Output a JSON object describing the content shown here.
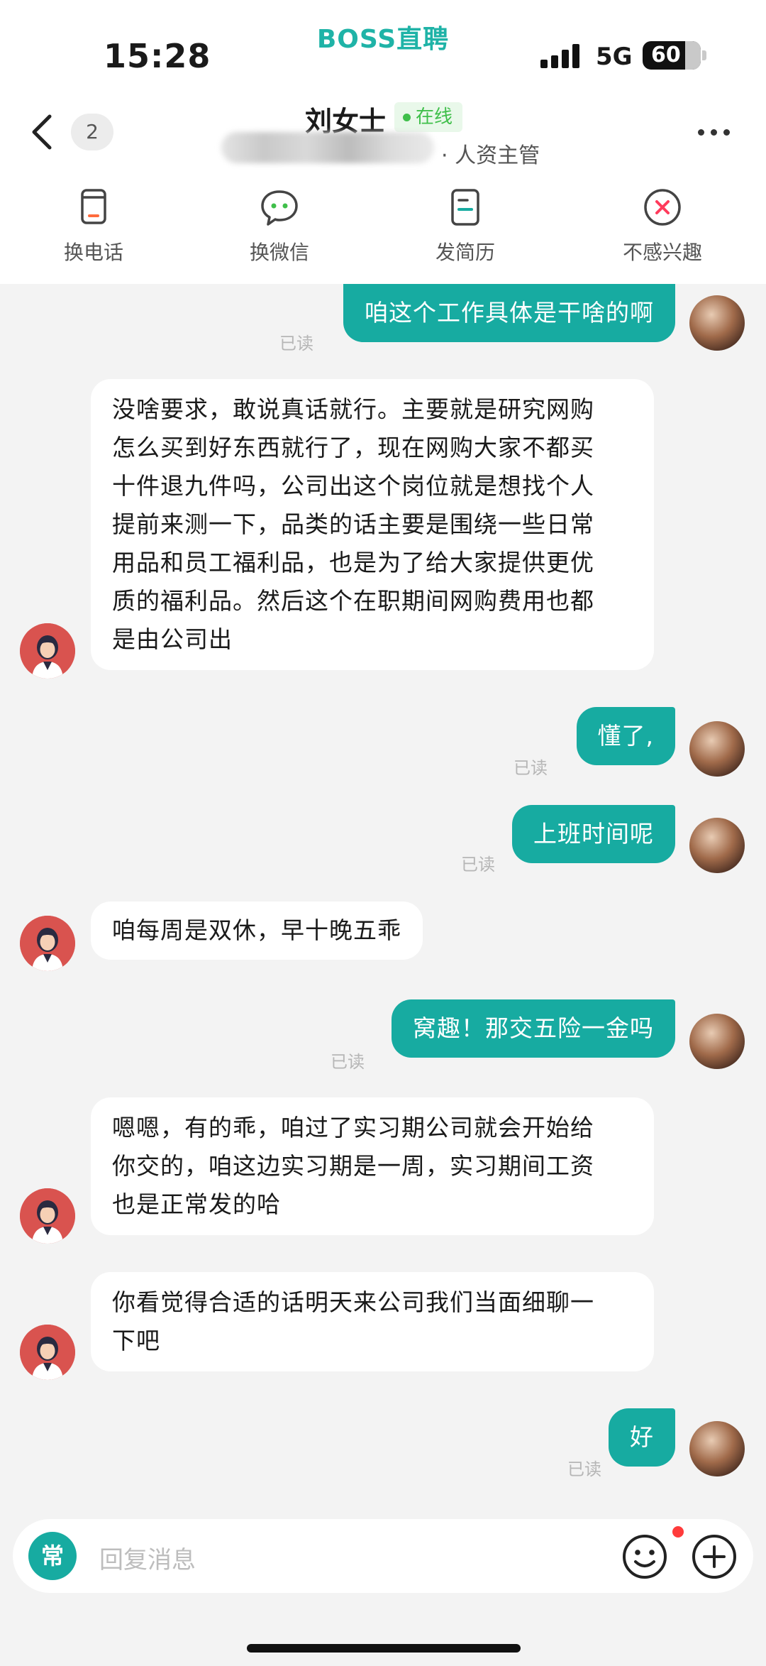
{
  "status_bar": {
    "time": "15:28",
    "network": "5G",
    "battery": "60"
  },
  "brand": "BOSS直聘",
  "header": {
    "unread_count": "2",
    "contact_name": "刘女士",
    "online_status": "在线",
    "role": "· 人资主管"
  },
  "actions": [
    {
      "label": "换电话",
      "icon": "phone-icon"
    },
    {
      "label": "换微信",
      "icon": "wechat-icon"
    },
    {
      "label": "发简历",
      "icon": "resume-icon"
    },
    {
      "label": "不感兴趣",
      "icon": "not-interested-icon"
    }
  ],
  "messages": [
    {
      "from": "me",
      "text": "咱这个工作具体是干啥的啊",
      "read": "已读"
    },
    {
      "from": "hr",
      "lines": [
        "没啥要求，敢说真话就行。主要就是研究网购",
        "怎么买到好东西就行了，现在网购大家不都买",
        "十件退九件吗，公司出这个岗位就是想找个人",
        "提前来测一下，品类的话主要是围绕一些日常",
        "用品和员工福利品，也是为了给大家提供更优",
        "质的福利品。然后这个在职期间网购费用也都",
        "是由公司出"
      ]
    },
    {
      "from": "me",
      "text": "懂了,",
      "read": "已读"
    },
    {
      "from": "me",
      "text": "上班时间呢",
      "read": "已读"
    },
    {
      "from": "hr",
      "lines": [
        "咱每周是双休，早十晚五乖"
      ]
    },
    {
      "from": "me",
      "text": "窝趣！那交五险一金吗",
      "read": "已读"
    },
    {
      "from": "hr",
      "lines": [
        "嗯嗯，有的乖，咱过了实习期公司就会开始给",
        "你交的，咱这边实习期是一周，实习期间工资",
        "也是正常发的哈"
      ]
    },
    {
      "from": "hr",
      "lines": [
        "你看觉得合适的话明天来公司我们当面细聊一",
        "下吧"
      ]
    },
    {
      "from": "me",
      "text": "好",
      "read": "已读"
    }
  ],
  "input": {
    "quick_reply": "常",
    "placeholder": "回复消息"
  },
  "colors": {
    "accent": "#17aba1",
    "brand": "#1fb3a7",
    "online": "#3fbf4a",
    "hr_avatar": "#d9534f"
  }
}
